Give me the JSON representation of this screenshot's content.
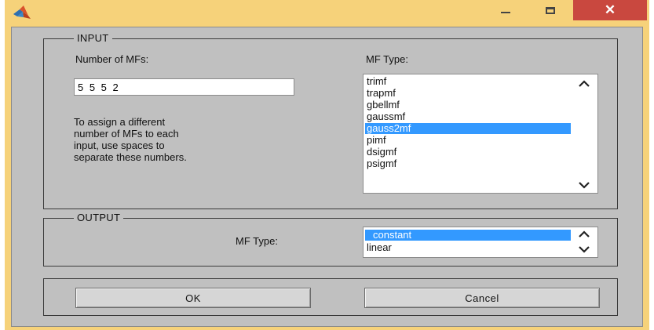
{
  "window": {
    "title_bar_color": "#f6d27a",
    "close_glyph": "✕",
    "icons": [
      "matlab-icon",
      "minimize-icon",
      "maximize-icon",
      "close-icon"
    ]
  },
  "input": {
    "group_label": "INPUT",
    "num_mfs_label": "Number of MFs:",
    "num_mfs_value": "5 5 5 2",
    "hint_line1": "To assign a different",
    "hint_line2": "number of MFs to each",
    "hint_line3": "input, use spaces to",
    "hint_line4": "separate these numbers.",
    "mf_type_label": "MF Type:",
    "mf_types": [
      "trimf",
      "trapmf",
      "gbellmf",
      "gaussmf",
      "gauss2mf",
      "pimf",
      "dsigmf",
      "psigmf"
    ],
    "selected_mf_type": "gauss2mf"
  },
  "output": {
    "group_label": "OUTPUT",
    "mf_type_label": "MF Type:",
    "mf_types": [
      "constant",
      "linear"
    ],
    "selected_mf_type": "constant"
  },
  "buttons": {
    "ok_label": "OK",
    "cancel_label": "Cancel"
  },
  "colors": {
    "selection": "#3399ff",
    "panel_bg": "#c0c0c0",
    "close_button": "#c9483f"
  }
}
